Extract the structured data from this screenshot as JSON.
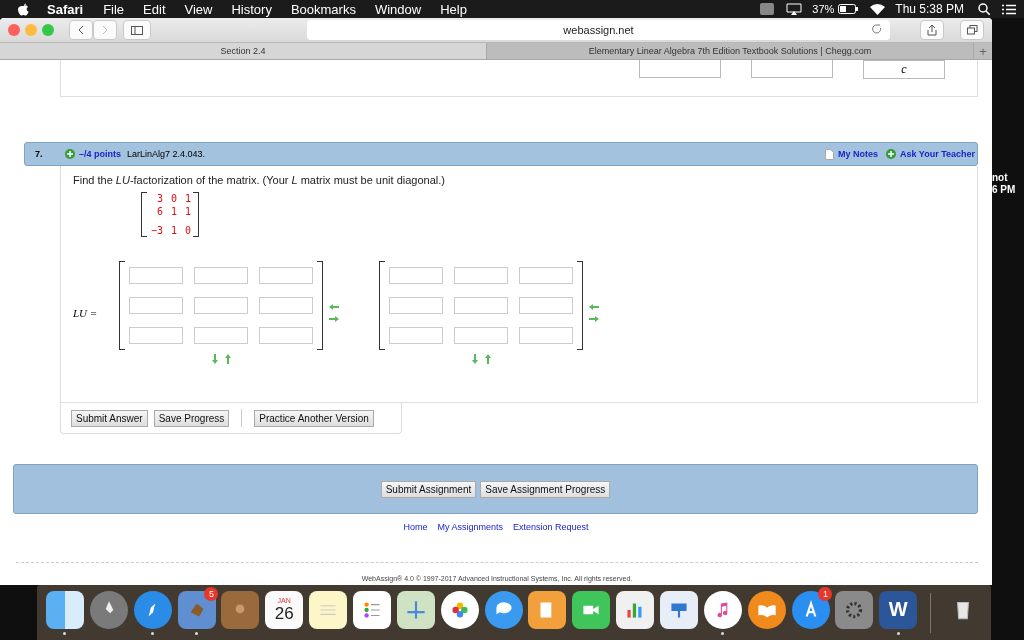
{
  "menubar": {
    "app": "Safari",
    "menus": [
      "File",
      "Edit",
      "View",
      "History",
      "Bookmarks",
      "Window",
      "Help"
    ],
    "battery": "37%",
    "clock": "Thu 5:38 PM"
  },
  "browser": {
    "address": "webassign.net",
    "tabs": [
      {
        "label": "Section 2.4",
        "selected": true
      },
      {
        "label": "Elementary Linear Algebra 7th Edition Textbook Solutions | Chegg.com",
        "selected": false
      }
    ],
    "new_tab": "+"
  },
  "previous_question": {
    "cell_text": "c"
  },
  "question": {
    "number": "7.",
    "points": "–/4 points",
    "code": "LarLinAlg7 2.4.043.",
    "my_notes": "My Notes",
    "ask_teacher": "Ask Your Teacher",
    "prompt": "Find the *LU*-factorization of the matrix. (Your *L* matrix must be unit diagonal.)",
    "matrix": [
      [
        "3",
        "0",
        "1"
      ],
      [
        "6",
        "1",
        "1"
      ],
      [
        "−3",
        "1",
        "0"
      ]
    ],
    "lu_label": "LU =",
    "answer_matrices": [
      {
        "kind": "grid3"
      },
      {
        "kind": "grid3"
      }
    ],
    "buttons": [
      "Submit Answer",
      "Save Progress",
      "Practice Another Version"
    ]
  },
  "assignment_buttons": [
    "Submit Assignment",
    "Save Assignment Progress"
  ],
  "links": [
    "Home",
    "My Assignments",
    "Extension Request"
  ],
  "footer": "WebAssign® 4.0 © 1997-2017 Advanced Instructional Systems, Inc. All rights reserved.",
  "background_window": [
    "not",
    "6 PM"
  ],
  "dock": [
    {
      "kind": "finder",
      "running": true
    },
    {
      "kind": "launchpad",
      "running": false
    },
    {
      "kind": "safari",
      "running": true
    },
    {
      "kind": "mail",
      "running": true,
      "badge": "5"
    },
    {
      "kind": "contacts",
      "running": false
    },
    {
      "kind": "calendar",
      "running": false,
      "month": "JAN",
      "day": "26"
    },
    {
      "kind": "notes",
      "running": false
    },
    {
      "kind": "reminders",
      "running": false
    },
    {
      "kind": "maps",
      "running": false
    },
    {
      "kind": "photos",
      "running": false
    },
    {
      "kind": "messages",
      "running": false
    },
    {
      "kind": "pages",
      "running": false
    },
    {
      "kind": "facetime",
      "running": false
    },
    {
      "kind": "numbers",
      "running": false
    },
    {
      "kind": "keynote",
      "running": false
    },
    {
      "kind": "itunes",
      "running": true
    },
    {
      "kind": "ibooks",
      "running": false
    },
    {
      "kind": "appstore",
      "running": false,
      "badge": "1"
    },
    {
      "kind": "preferences",
      "running": false
    },
    {
      "kind": "word",
      "running": true,
      "letter": "W"
    },
    {
      "kind": "trash",
      "running": false
    }
  ]
}
